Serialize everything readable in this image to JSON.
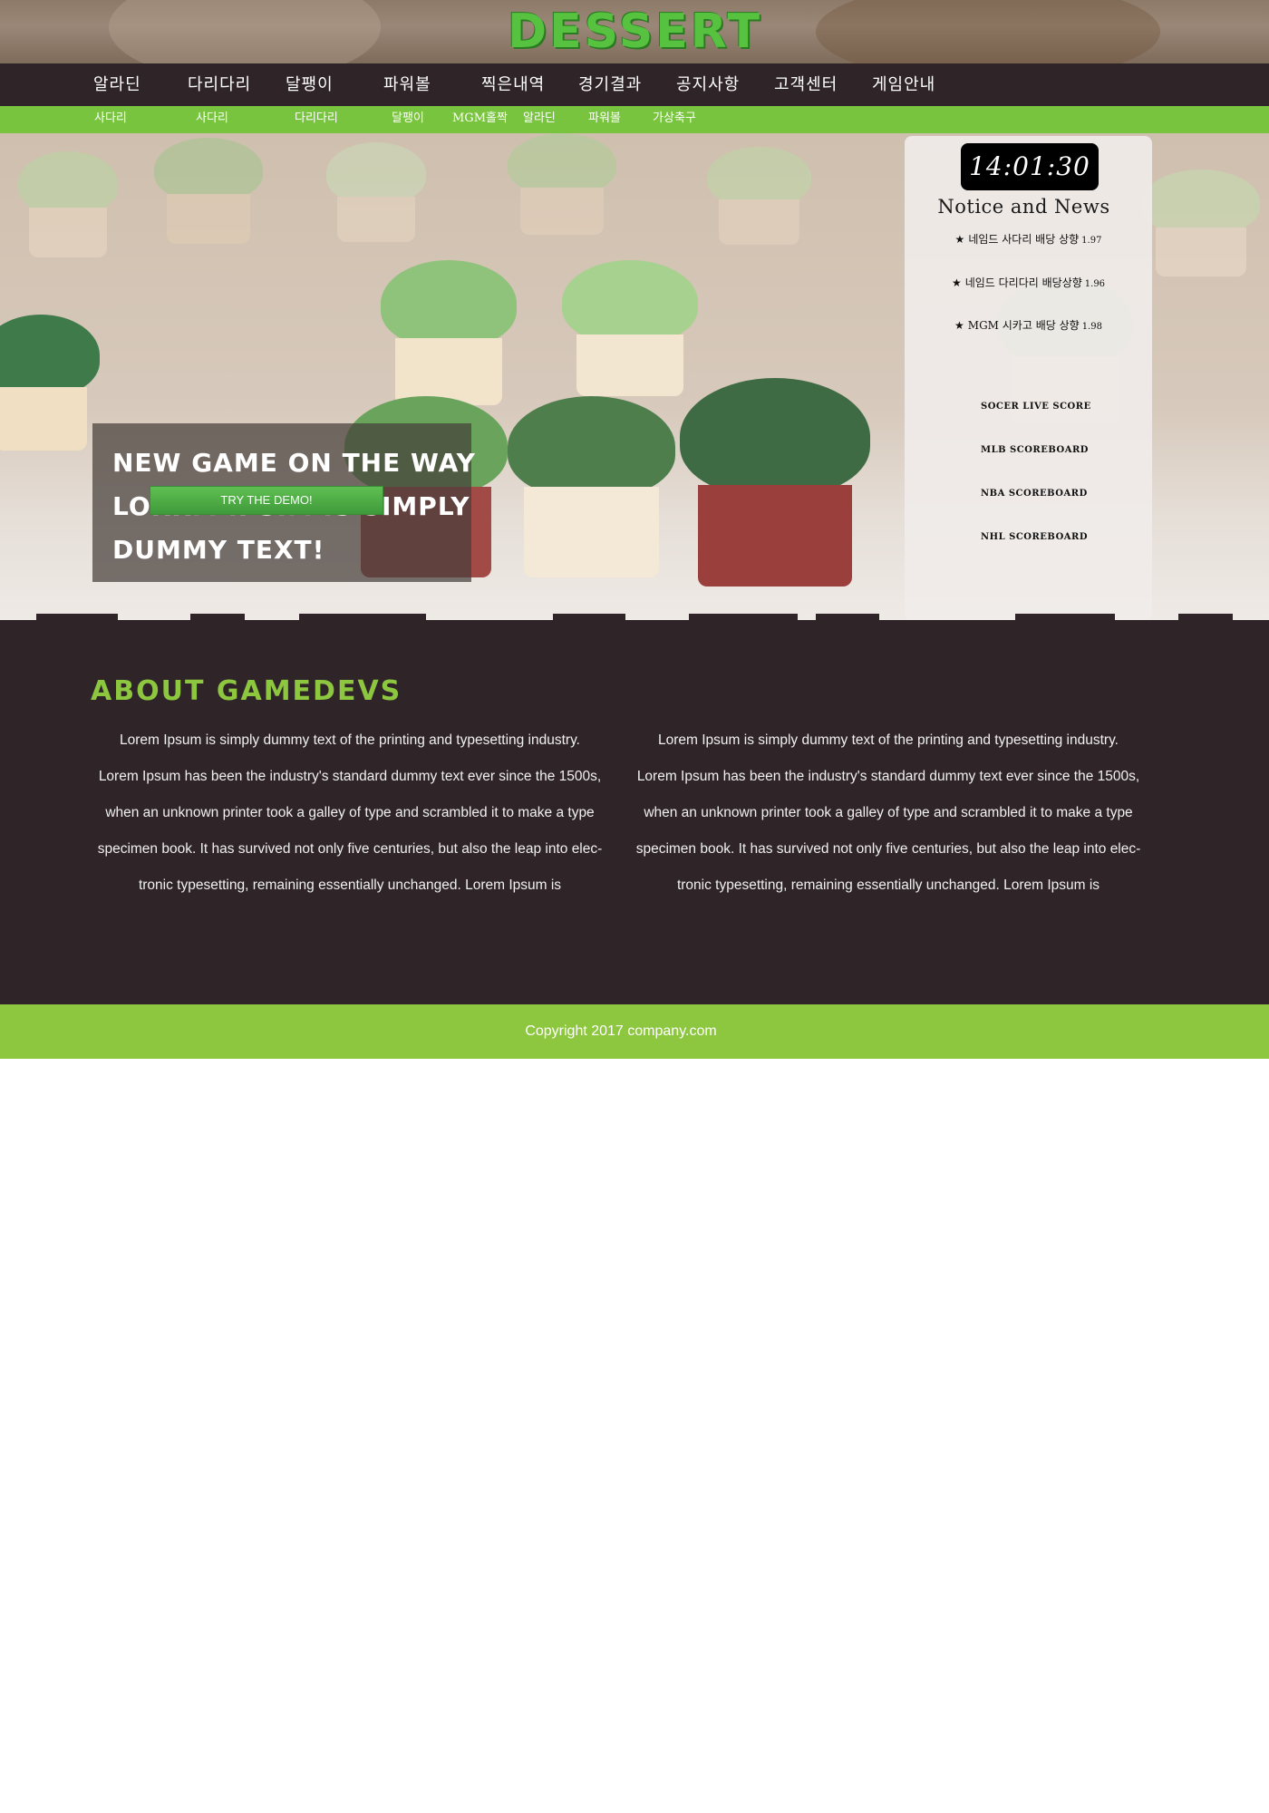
{
  "brand": {
    "logo_text": "DESSERT"
  },
  "main_nav": [
    {
      "label": "알라딘"
    },
    {
      "label": "다리다리"
    },
    {
      "label": "달팽이"
    },
    {
      "label": "파워볼"
    },
    {
      "label": "찍은내역"
    },
    {
      "label": "경기결과"
    },
    {
      "label": "공지사항"
    },
    {
      "label": "고객센터"
    },
    {
      "label": "게임안내"
    }
  ],
  "sub_nav": [
    {
      "label": "사다리"
    },
    {
      "label": "사다리"
    },
    {
      "label": "다리다리"
    },
    {
      "label": "달팽이"
    },
    {
      "label": "MGM홀짝"
    },
    {
      "label": "알라딘"
    },
    {
      "label": "파워볼"
    },
    {
      "label": "가상축구"
    }
  ],
  "hero": {
    "caption_lines": [
      "New game on the way",
      "lorrm ipsim is simply",
      "dummy text!"
    ],
    "demo_button": "TRY THE DEMO!"
  },
  "side_panel": {
    "clock": "14:01:30",
    "notice_title": "Notice and News",
    "notices": [
      {
        "star": "★",
        "text": "네임드 사다리 배당 상향",
        "odds": "1.97"
      },
      {
        "star": "★",
        "text": "네임드 다리다리 배당상향",
        "odds": "1.96"
      },
      {
        "star": "★",
        "text": "MGM 시카고 배당 상향",
        "odds": "1.98"
      }
    ],
    "score_links": [
      {
        "label": "SOCER LIVE SCORE"
      },
      {
        "label": "MLB SCOREBOARD"
      },
      {
        "label": "NBA SCOREBOARD"
      },
      {
        "label": "NHL SCOREBOARD"
      }
    ]
  },
  "about": {
    "title": "About GameDevs",
    "columns": [
      {
        "lines": [
          "Lorem Ipsum is simply dummy text of the printing and typesetting industry.",
          "Lorem Ipsum has been the industry's standard dummy text ever since the 1500s,",
          "when an unknown printer took a galley of type and scrambled it to make a type",
          "specimen book. It has survived not only five centuries, but also the leap into elec-",
          "tronic typesetting, remaining essentially unchanged. Lorem Ipsum is"
        ]
      },
      {
        "lines": [
          "Lorem Ipsum is simply dummy text of the printing and typesetting industry.",
          "Lorem Ipsum has been the industry's standard dummy text ever since the 1500s,",
          "when an unknown printer took a galley of type and scrambled it to make a type",
          "specimen book. It has survived not only five centuries, but also the leap into elec-",
          "tronic typesetting, remaining essentially unchanged. Lorem Ipsum is"
        ]
      }
    ]
  },
  "footer": {
    "copyright": "Copyright 2017 company.com"
  },
  "colors": {
    "brand_green": "#8dc63f",
    "nav_dark": "#2f2529",
    "sub_nav_green": "#79c43e",
    "button_green": "#4fae46"
  }
}
